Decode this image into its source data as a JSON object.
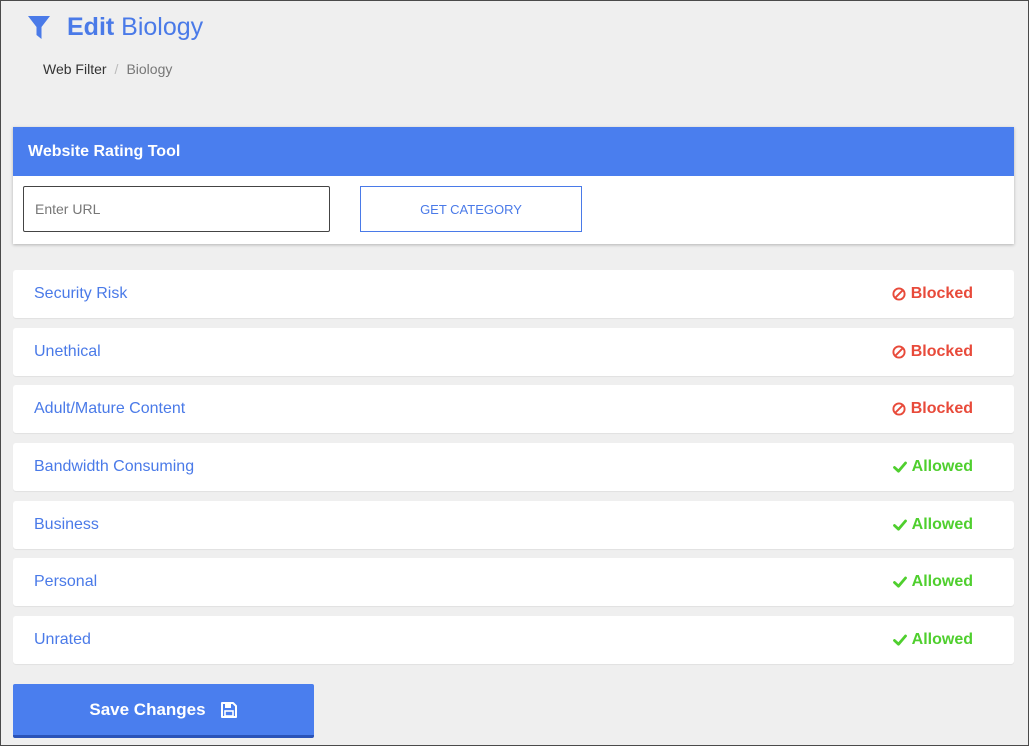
{
  "header": {
    "title_strong": "Edit",
    "title_rest": "Biology",
    "icon": "filter-icon"
  },
  "breadcrumb": {
    "items": [
      "Web Filter",
      "Biology"
    ],
    "separator": "/"
  },
  "rating_tool": {
    "title": "Website Rating Tool",
    "url_placeholder": "Enter URL",
    "url_value": "",
    "button_label": "GET CATEGORY"
  },
  "categories": [
    {
      "name": "Security Risk",
      "status": "Blocked"
    },
    {
      "name": "Unethical",
      "status": "Blocked"
    },
    {
      "name": "Adult/Mature Content",
      "status": "Blocked"
    },
    {
      "name": "Bandwidth Consuming",
      "status": "Allowed"
    },
    {
      "name": "Business",
      "status": "Allowed"
    },
    {
      "name": "Personal",
      "status": "Allowed"
    },
    {
      "name": "Unrated",
      "status": "Allowed"
    }
  ],
  "save_button": {
    "label": "Save Changes",
    "icon": "floppy-disk-icon"
  },
  "colors": {
    "accent": "#4a7eee",
    "blocked": "#e84a3a",
    "allowed": "#4fcf2e",
    "background": "#efefef"
  }
}
